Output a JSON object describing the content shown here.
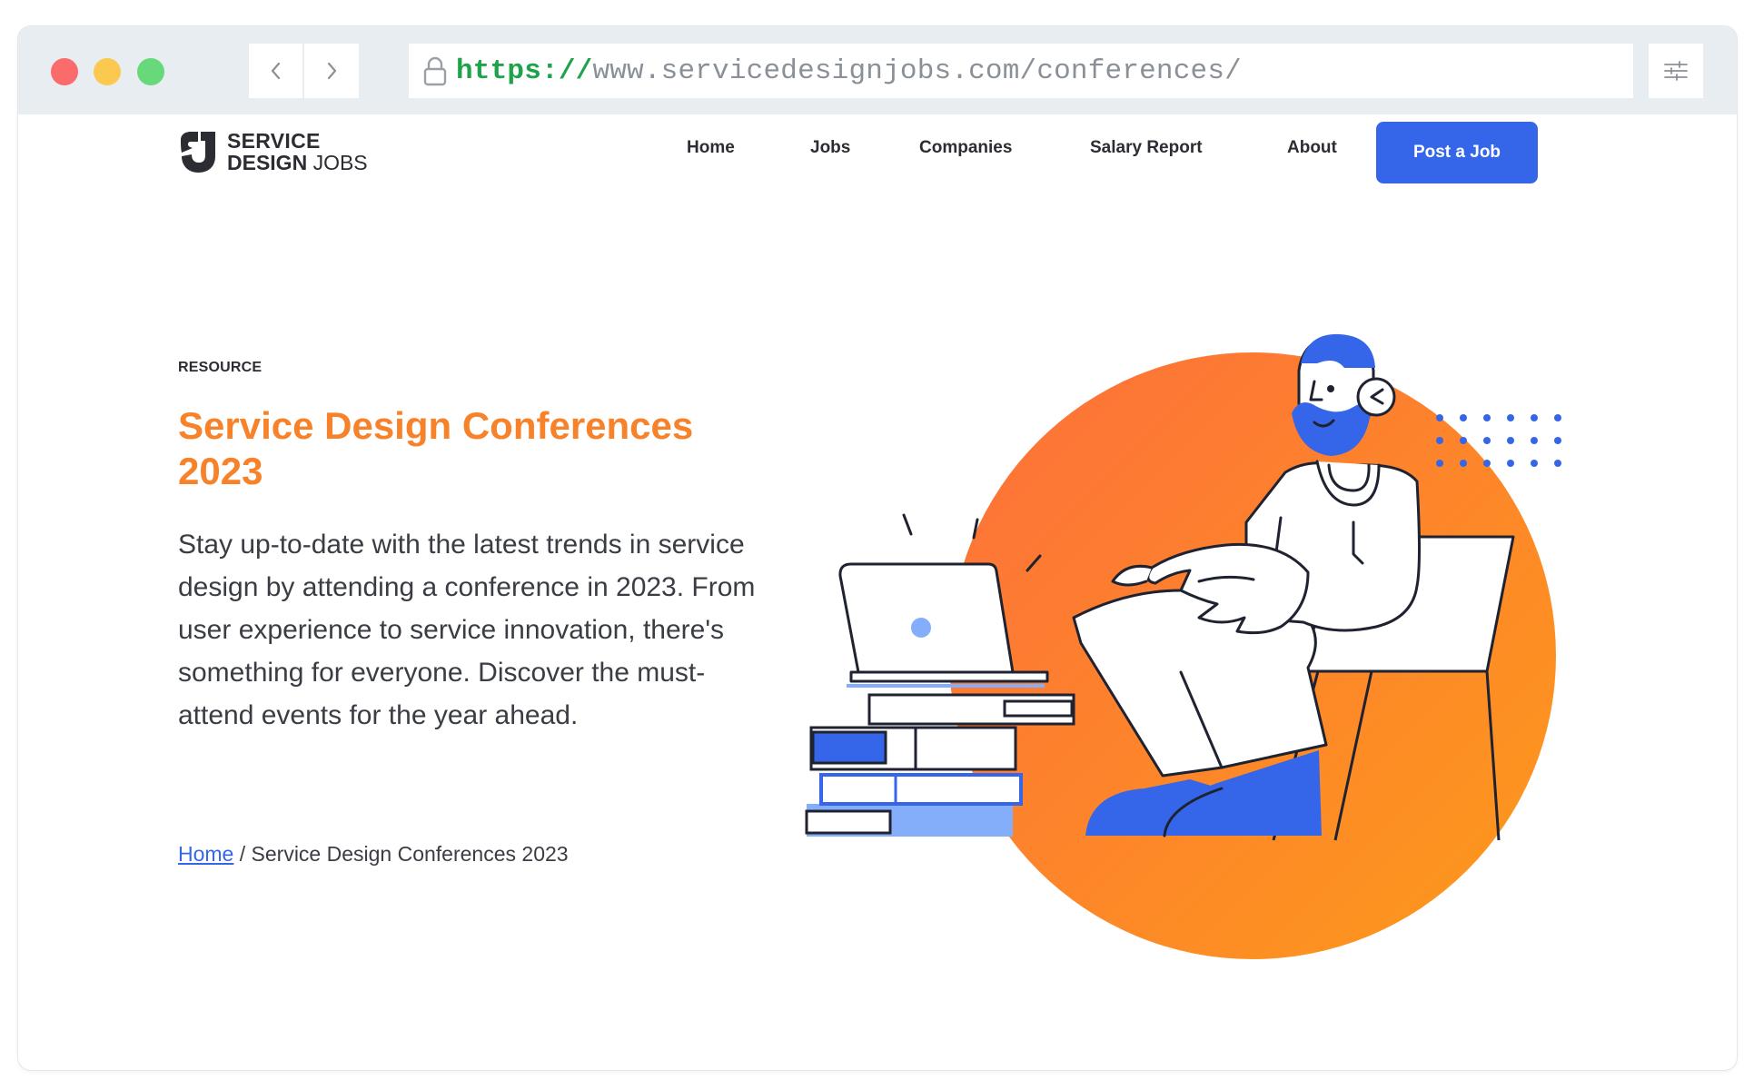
{
  "browser": {
    "url_scheme": "https://",
    "url_rest": "www.servicedesignjobs.com/conferences/"
  },
  "logo": {
    "line1": "SERVICE",
    "line2_bold": "DESIGN",
    "line2_light": "JOBS"
  },
  "nav": {
    "items": [
      "Home",
      "Jobs",
      "Companies",
      "Salary Report",
      "About"
    ],
    "cta": "Post a Job"
  },
  "hero": {
    "eyebrow": "RESOURCE",
    "title": "Service Design Conferences 2023",
    "description": "Stay up-to-date with the latest trends in service design by attending a conference in 2023. From user experience to service innovation, there's something for everyone. Discover the must-attend events for the year ahead.",
    "breadcrumb_home": "Home",
    "breadcrumb_sep": "/",
    "breadcrumb_current": "Service Design Conferences 2023"
  },
  "colors": {
    "accent_blue": "#3566ea",
    "title_orange": "#f7822a",
    "circle_start": "#fd6f3b",
    "circle_end": "#fd9a1a"
  },
  "icons": [
    "lock-icon",
    "back-arrow-icon",
    "forward-arrow-icon",
    "sliders-icon",
    "logo-mark-icon"
  ]
}
